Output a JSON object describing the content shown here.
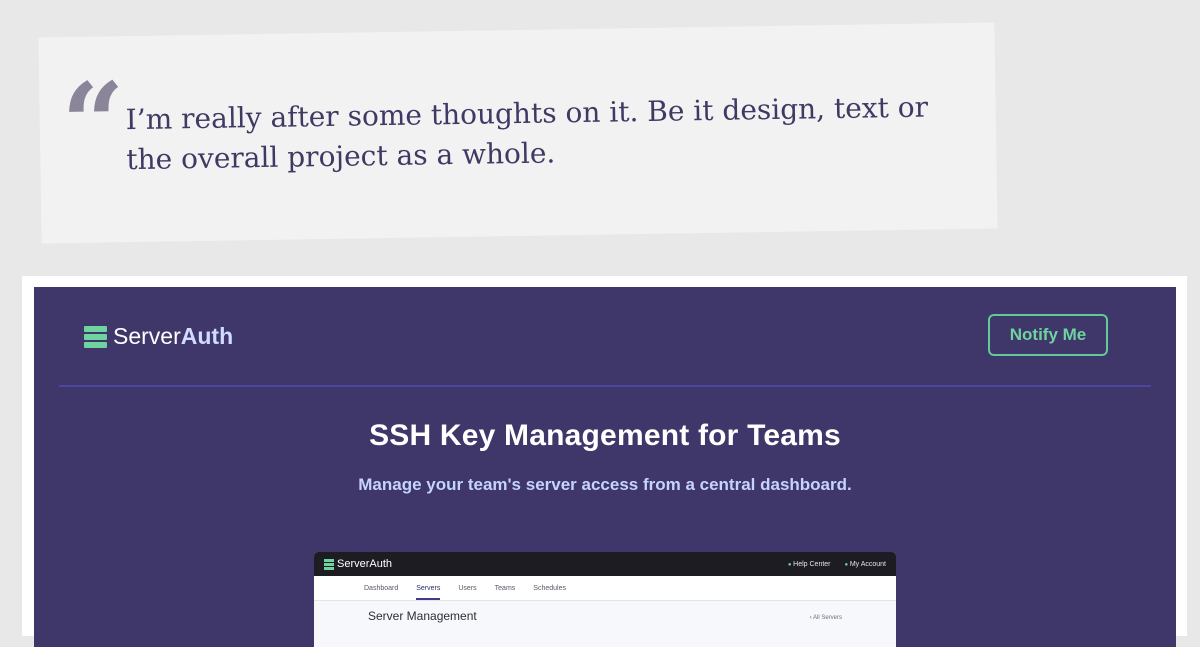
{
  "quote": {
    "mark": "“",
    "text": "I’m really after some thoughts on it. Be it design, text or the overall project as a whole."
  },
  "header": {
    "brand_prefix": "Server",
    "brand_suffix": "Auth",
    "notify_label": "Notify Me"
  },
  "hero": {
    "title": "SSH Key Management for Teams",
    "subtitle": "Manage your team's server access from a central dashboard."
  },
  "preview": {
    "brand": "ServerAuth",
    "help_center": "Help Center",
    "my_account": "My Account",
    "nav": [
      "Dashboard",
      "Servers",
      "Users",
      "Teams",
      "Schedules"
    ],
    "active_nav": "Servers",
    "heading": "Server Management",
    "all_servers_link": "‹ All Servers"
  },
  "colors": {
    "hero_bg": "#3f3669",
    "accent_green": "#6fd39f",
    "quote_text": "#3e3a64"
  }
}
